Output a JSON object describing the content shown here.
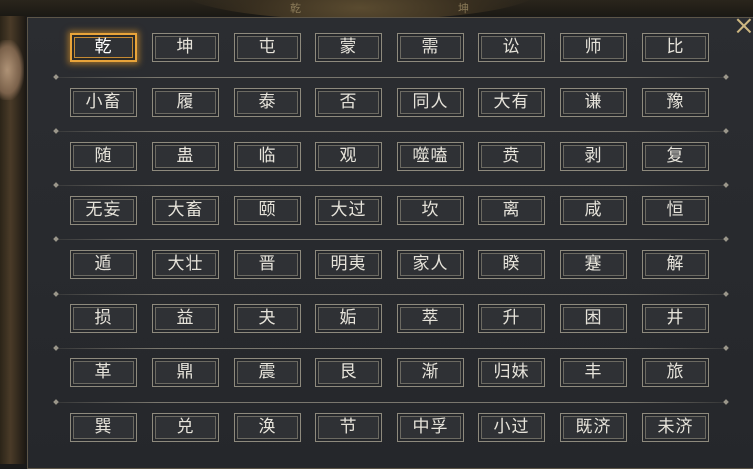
{
  "background": {
    "top_glyphs": [
      "乾",
      "坤"
    ]
  },
  "panel": {
    "close_icon": "×",
    "selected": "乾",
    "rows": [
      [
        "乾",
        "坤",
        "屯",
        "蒙",
        "需",
        "讼",
        "师",
        "比"
      ],
      [
        "小畜",
        "履",
        "泰",
        "否",
        "同人",
        "大有",
        "谦",
        "豫"
      ],
      [
        "随",
        "蛊",
        "临",
        "观",
        "噬嗑",
        "贲",
        "剥",
        "复"
      ],
      [
        "无妄",
        "大畜",
        "颐",
        "大过",
        "坎",
        "离",
        "咸",
        "恒"
      ],
      [
        "遁",
        "大壮",
        "晋",
        "明夷",
        "家人",
        "睽",
        "蹇",
        "解"
      ],
      [
        "损",
        "益",
        "夬",
        "姤",
        "萃",
        "升",
        "困",
        "井"
      ],
      [
        "革",
        "鼎",
        "震",
        "艮",
        "渐",
        "归妹",
        "丰",
        "旅"
      ],
      [
        "巽",
        "兑",
        "涣",
        "节",
        "中孚",
        "小过",
        "既济",
        "未济"
      ]
    ]
  },
  "colors": {
    "highlight": "#e9a43a",
    "text": "#e6e3da",
    "cell_border": "#8e8a7d"
  }
}
